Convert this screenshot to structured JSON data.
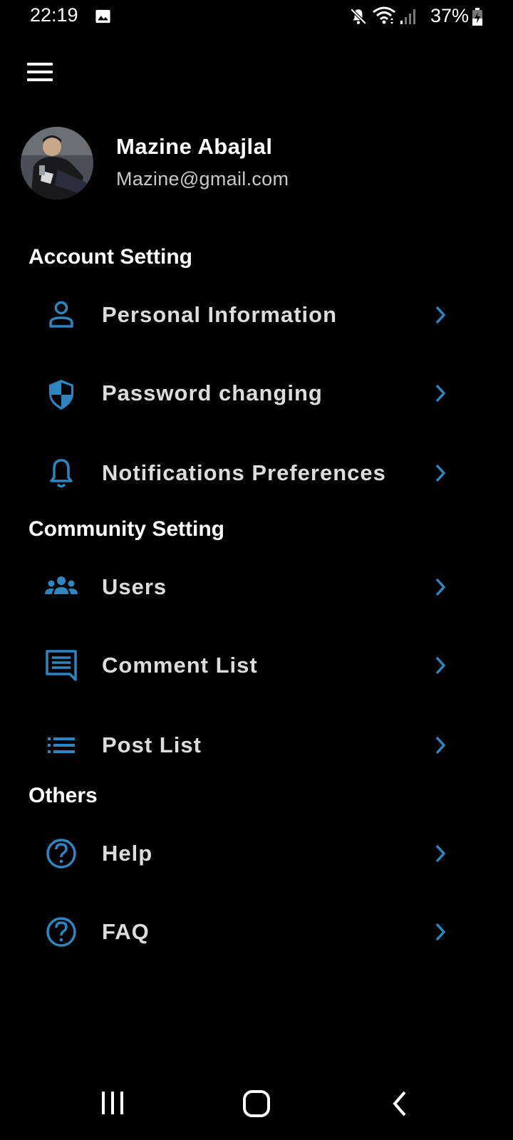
{
  "status_bar": {
    "time": "22:19",
    "battery": "37%",
    "icons": [
      "image-icon",
      "mute-icon",
      "wifi-icon",
      "signal-icon",
      "battery-charging-icon"
    ]
  },
  "header": {
    "menu_icon": "hamburger-menu-icon"
  },
  "profile": {
    "name": "Mazine Abajlal",
    "email": "Mazine@gmail.com"
  },
  "sections": [
    {
      "title": "Account Setting",
      "items": [
        {
          "label": "Personal Information",
          "icon": "person-icon"
        },
        {
          "label": "Password changing",
          "icon": "shield-icon"
        },
        {
          "label": "Notifications Preferences",
          "icon": "bell-icon"
        }
      ]
    },
    {
      "title": "Community Setting",
      "items": [
        {
          "label": "Users",
          "icon": "group-icon"
        },
        {
          "label": "Comment List",
          "icon": "comment-icon"
        },
        {
          "label": "Post List",
          "icon": "list-icon"
        }
      ]
    },
    {
      "title": "Others",
      "items": [
        {
          "label": "Help",
          "icon": "help-circle-icon"
        },
        {
          "label": "FAQ",
          "icon": "help-circle-icon"
        }
      ]
    }
  ],
  "colors": {
    "background": "#000000",
    "accent": "#2e86c1",
    "label": "#dcdcdc",
    "secondary_text": "#c9c9c9"
  },
  "nav_bar": {
    "buttons": [
      "recent-apps-icon",
      "home-icon",
      "back-icon"
    ]
  }
}
